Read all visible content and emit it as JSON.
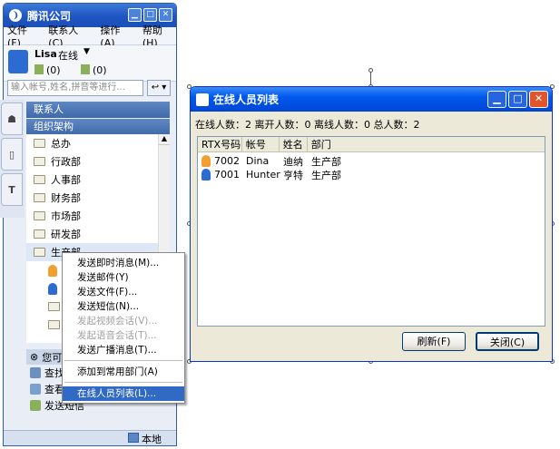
{
  "main_window": {
    "title": "腾讯公司",
    "menu": [
      "文件(F)",
      "联系人(C)",
      "操作(A)",
      "帮助(H)"
    ],
    "user": {
      "name": "Lisa",
      "status": "在线"
    },
    "counters": [
      "(0)",
      "(0)"
    ],
    "search_placeholder": "输入帐号,姓名,拼音等进行...",
    "sections": {
      "contacts": "联系人",
      "org": "组织架构"
    },
    "departments": [
      "总办",
      "行政部",
      "人事部",
      "财务部",
      "市场部",
      "研发部",
      "生产部"
    ],
    "bottom_header": "您可",
    "bottom_items": [
      "查找",
      "查看",
      "发送短信"
    ],
    "status_text": "本地"
  },
  "context_menu": {
    "items": [
      {
        "label": "发送即时消息(M)...",
        "disabled": false
      },
      {
        "label": "发送邮件(Y)",
        "disabled": false
      },
      {
        "label": "发送文件(F)...",
        "disabled": false
      },
      {
        "label": "发送短信(N)...",
        "disabled": false
      },
      {
        "label": "发起视频会话(V)...",
        "disabled": true
      },
      {
        "label": "发起语音会话(T)...",
        "disabled": true
      },
      {
        "label": "发送广播消息(T)...",
        "disabled": false
      },
      {
        "label": "添加到常用部门(A)",
        "disabled": false
      },
      {
        "label": "在线人员列表(L)...",
        "disabled": false,
        "selected": true
      }
    ]
  },
  "dialog": {
    "title": "在线人员列表",
    "summary": "在线人数：2 离开人数：0 离线人数：0 总人数：2",
    "columns": [
      "RTX号码",
      "帐号",
      "姓名",
      "部门"
    ],
    "rows": [
      {
        "rtx": "7002",
        "account": "Dina",
        "name": "迪纳",
        "dept": "生产部",
        "gender": "female"
      },
      {
        "rtx": "7001",
        "account": "Hunter",
        "name": "亨特",
        "dept": "生产部",
        "gender": "male"
      }
    ],
    "buttons": {
      "refresh": "刷新(F)",
      "close": "关闭(C)"
    }
  },
  "colors": {
    "titlebar": "#1f55c3",
    "dialog_titlebar": "#0058ee",
    "selection": "#316ac5",
    "female_icon": "#f0a030",
    "male_icon": "#2c6bd1"
  }
}
